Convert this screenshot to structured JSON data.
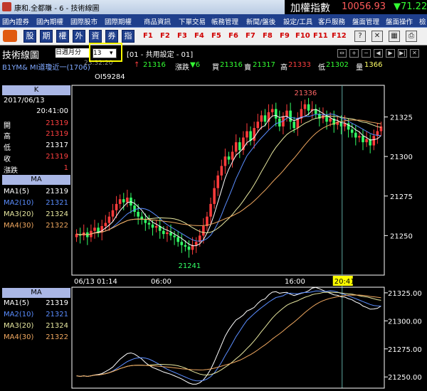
{
  "window": {
    "title": "康和.全都賺 - 6 - 技術線圖"
  },
  "index_quote": {
    "name": "加權指數",
    "value": "10056.93",
    "change": "▼71.22"
  },
  "menu": [
    "國內證券",
    "國內期權",
    "國際股市",
    "國際期權",
    "商品資訊",
    "下單交易",
    "帳務管理",
    "新聞/盤後",
    "設定/工具",
    "客戶服務",
    "盤面管理",
    "盤面操作",
    "檢"
  ],
  "toolbar": {
    "buttons": [
      "股",
      "期",
      "權",
      "外",
      "資",
      "券",
      "指"
    ],
    "fkeys": [
      "F1",
      "F2",
      "F3",
      "F4",
      "F5",
      "F6",
      "F7",
      "F8",
      "F9",
      "F10",
      "F11",
      "F12"
    ]
  },
  "panel": {
    "title": "技術線圖",
    "period": "日週月分",
    "interval": "13",
    "setting": "[01 - 共用設定 - 01]",
    "time_hint": "23:32:20"
  },
  "quote_line": {
    "symbol": "B1YM&  MI道瓊近一(1706)",
    "price": "21316",
    "change_label": "漲跌",
    "change": "▼6",
    "bid_label": "買",
    "bid": "21316",
    "ask_label": "賣",
    "ask": "21317",
    "high_label": "高",
    "high": "21333",
    "low_label": "低",
    "low": "21302",
    "volume_label": "量",
    "volume": "1366",
    "oi": "OI59284"
  },
  "k_info": {
    "header": "K",
    "date": "2017/06/13",
    "time": "20:41:00",
    "rows": [
      {
        "label": "開",
        "value": "21319",
        "color": "#ff4040"
      },
      {
        "label": "高",
        "value": "21319",
        "color": "#ff4040"
      },
      {
        "label": "低",
        "value": "21317",
        "color": "#ffffff"
      },
      {
        "label": "收",
        "value": "21319",
        "color": "#ff4040"
      },
      {
        "label": "漲跌",
        "value": "1",
        "color": "#ff4040"
      }
    ]
  },
  "ma_info": {
    "header": "MA",
    "rows": [
      {
        "label": "MA1(5)",
        "value": "21319",
        "color": "#ffffff"
      },
      {
        "label": "MA2(10)",
        "value": "21321",
        "color": "#5a8dff"
      },
      {
        "label": "MA3(20)",
        "value": "21324",
        "color": "#e8e8a0"
      },
      {
        "label": "MA4(30)",
        "value": "21322",
        "color": "#f0a860"
      }
    ]
  },
  "ma_info2": {
    "header": "MA",
    "rows": [
      {
        "label": "MA1(5)",
        "value": "21319",
        "color": "#ffffff"
      },
      {
        "label": "MA2(10)",
        "value": "21321",
        "color": "#5a8dff"
      },
      {
        "label": "MA3(20)",
        "value": "21324",
        "color": "#e8e8a0"
      },
      {
        "label": "MA4(30)",
        "value": "21322",
        "color": "#f0a860"
      }
    ]
  },
  "chart_data": [
    {
      "type": "candlestick",
      "title": "",
      "ylim": [
        21225,
        21345
      ],
      "y_ticks": [
        21250,
        21275,
        21300,
        21325
      ],
      "x_labels": [
        "06/13 01:14",
        "06:00",
        "16:00"
      ],
      "cursor_label": "20:41",
      "max_label": "21336",
      "min_label": "21241",
      "close": [
        21251,
        21250,
        21252,
        21249,
        21253,
        21255,
        21252,
        21256,
        21258,
        21262,
        21266,
        21270,
        21273,
        21271,
        21274,
        21269,
        21265,
        21262,
        21260,
        21258,
        21257,
        21255,
        21256,
        21253,
        21251,
        21252,
        21250,
        21249,
        21246,
        21244,
        21243,
        21241,
        21244,
        21246,
        21250,
        21256,
        21262,
        21270,
        21280,
        21288,
        21294,
        21300,
        21298,
        21303,
        21309,
        21304,
        21312,
        21316,
        21310,
        21318,
        21322,
        21326,
        21322,
        21328,
        21330,
        21324,
        21319,
        21325,
        21329,
        21322,
        21318,
        21324,
        21330,
        21333,
        21329,
        21330,
        21327,
        21324,
        21326,
        21322,
        21324,
        21320,
        21322,
        21319,
        21321,
        21317,
        21315,
        21312,
        21313,
        21309,
        21311,
        21307,
        21313,
        21316,
        21319
      ],
      "series": [
        {
          "name": "MA1(5)",
          "color": "#ffffff"
        },
        {
          "name": "MA2(10)",
          "color": "#5a8dff"
        },
        {
          "name": "MA3(20)",
          "color": "#e8e8a0"
        },
        {
          "name": "MA4(30)",
          "color": "#f0a860"
        }
      ]
    },
    {
      "type": "line",
      "title": "",
      "ylim": [
        21240,
        21330
      ],
      "y_ticks": [
        21250.0,
        21275.0,
        21300.0,
        21325.0
      ]
    }
  ]
}
